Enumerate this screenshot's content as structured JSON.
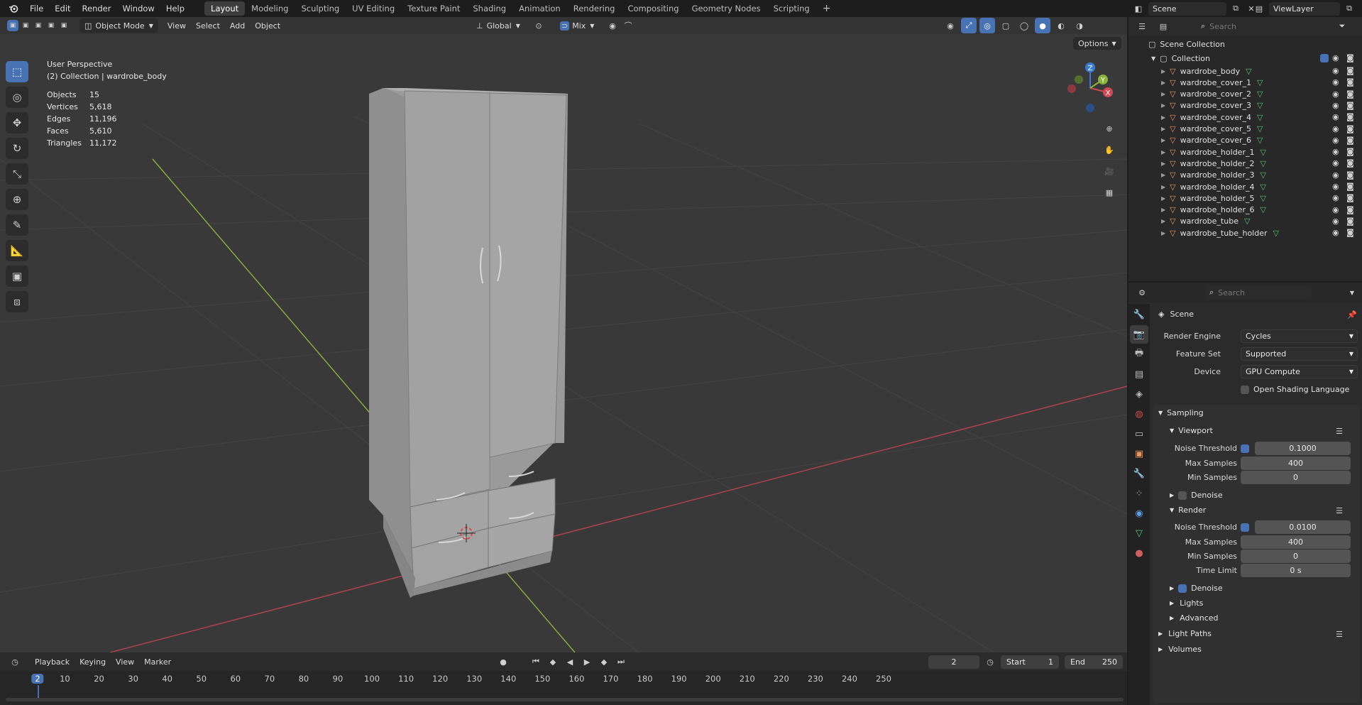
{
  "topbar": {
    "menus": [
      "File",
      "Edit",
      "Render",
      "Window",
      "Help"
    ],
    "workspaces": [
      "Layout",
      "Modeling",
      "Sculpting",
      "UV Editing",
      "Texture Paint",
      "Shading",
      "Animation",
      "Rendering",
      "Compositing",
      "Geometry Nodes",
      "Scripting"
    ],
    "active_workspace": "Layout",
    "add_tab": "+",
    "scene": "Scene",
    "view_layer": "ViewLayer"
  },
  "viewport": {
    "mode": "Object Mode",
    "menus": [
      "View",
      "Select",
      "Add",
      "Object"
    ],
    "orientation": "Global",
    "snap_target": "Mix",
    "options": "Options",
    "perspective": "User Perspective",
    "collection_info": "(2) Collection | wardrobe_body",
    "stats": [
      {
        "k": "Objects",
        "v": "15"
      },
      {
        "k": "Vertices",
        "v": "5,618"
      },
      {
        "k": "Edges",
        "v": "11,196"
      },
      {
        "k": "Faces",
        "v": "5,610"
      },
      {
        "k": "Triangles",
        "v": "11,172"
      }
    ],
    "gizmo": {
      "x": "X",
      "y": "Y",
      "z": "Z"
    }
  },
  "timeline": {
    "menus": [
      "Playback",
      "Keying",
      "View",
      "Marker"
    ],
    "current_frame": "2",
    "start_label": "Start",
    "start": "1",
    "end_label": "End",
    "end": "250",
    "ticks": [
      "2",
      "10",
      "20",
      "30",
      "40",
      "50",
      "60",
      "70",
      "80",
      "90",
      "100",
      "110",
      "120",
      "130",
      "140",
      "150",
      "160",
      "170",
      "180",
      "190",
      "200",
      "210",
      "220",
      "230",
      "240",
      "250"
    ]
  },
  "outliner": {
    "search_placeholder": "Search",
    "scene_collection": "Scene Collection",
    "collection": "Collection",
    "objects": [
      "wardrobe_body",
      "wardrobe_cover_1",
      "wardrobe_cover_2",
      "wardrobe_cover_3",
      "wardrobe_cover_4",
      "wardrobe_cover_5",
      "wardrobe_cover_6",
      "wardrobe_holder_1",
      "wardrobe_holder_2",
      "wardrobe_holder_3",
      "wardrobe_holder_4",
      "wardrobe_holder_5",
      "wardrobe_holder_6",
      "wardrobe_tube",
      "wardrobe_tube_holder"
    ]
  },
  "properties": {
    "search_placeholder": "Search",
    "context": "Scene",
    "render_engine_label": "Render Engine",
    "render_engine": "Cycles",
    "feature_set_label": "Feature Set",
    "feature_set": "Supported",
    "device_label": "Device",
    "device": "GPU Compute",
    "osl_label": "Open Shading Language",
    "sampling": "Sampling",
    "viewport": "Viewport",
    "noise_threshold_label": "Noise Threshold",
    "vp_noise_threshold": "0.1000",
    "max_samples_label": "Max Samples",
    "vp_max_samples": "400",
    "min_samples_label": "Min Samples",
    "vp_min_samples": "0",
    "denoise_label": "Denoise",
    "render": "Render",
    "r_noise_threshold": "0.0100",
    "r_max_samples": "400",
    "r_min_samples": "0",
    "time_limit_label": "Time Limit",
    "r_time_limit": "0 s",
    "lights": "Lights",
    "advanced": "Advanced",
    "light_paths": "Light Paths",
    "volumes": "Volumes"
  },
  "colors": {
    "accent": "#4772b3",
    "x_axis": "#d24a52",
    "y_axis": "#8ab33c",
    "z_axis": "#3a7bd5",
    "mesh_icon": "#e8965a",
    "data_icon": "#58c572"
  }
}
